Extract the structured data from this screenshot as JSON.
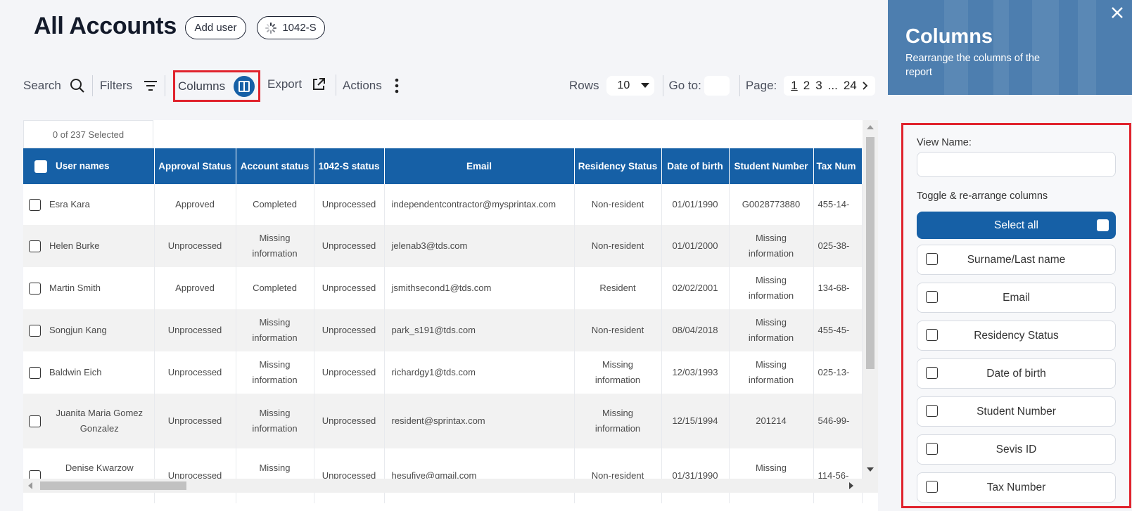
{
  "header": {
    "title": "All Accounts",
    "add_user": "Add user",
    "tag": "1042-S"
  },
  "toolbar": {
    "search": "Search",
    "filters": "Filters",
    "columns": "Columns",
    "export": "Export",
    "actions": "Actions",
    "rows_label": "Rows",
    "rows_value": "10",
    "goto_label": "Go to:",
    "page_label": "Page:",
    "pages": [
      "1",
      "2",
      "3",
      "...",
      "24"
    ]
  },
  "table": {
    "selected_count": "0 of 237 Selected",
    "columns": [
      "User names",
      "Approval Status",
      "Account status",
      "1042-S status",
      "Email",
      "Residency Status",
      "Date of birth",
      "Student Number",
      "Tax Num"
    ],
    "rows": [
      [
        "Esra Kara",
        "Approved",
        "Completed",
        "Unprocessed",
        "independentcontractor@mysprintax.com",
        "Non-resident",
        "01/01/1990",
        "G0028773880",
        "455-14-"
      ],
      [
        "Helen Burke",
        "Unprocessed",
        "Missing information",
        "Unprocessed",
        "jelenab3@tds.com",
        "Non-resident",
        "01/01/2000",
        "Missing information",
        "025-38-"
      ],
      [
        "Martin Smith",
        "Approved",
        "Completed",
        "Unprocessed",
        "jsmithsecond1@tds.com",
        "Resident",
        "02/02/2001",
        "Missing information",
        "134-68-"
      ],
      [
        "Songjun Kang",
        "Unprocessed",
        "Missing information",
        "Unprocessed",
        "park_s191@tds.com",
        "Non-resident",
        "08/04/2018",
        "Missing information",
        "455-45-"
      ],
      [
        "Baldwin Eich",
        "Unprocessed",
        "Missing information",
        "Unprocessed",
        "richardgy1@tds.com",
        "Missing information",
        "12/03/1993",
        "Missing information",
        "025-13-"
      ],
      [
        "Juanita Maria Gomez Gonzalez",
        "Unprocessed",
        "Missing information",
        "Unprocessed",
        "resident@sprintax.com",
        "Missing information",
        "12/15/1994",
        "201214",
        "546-99-"
      ],
      [
        "Denise Kwarzow Royalties",
        "Unprocessed",
        "Missing information",
        "Unprocessed",
        "hesufive@gmail.com",
        "Non-resident",
        "01/31/1990",
        "Missing information",
        "114-56-"
      ]
    ]
  },
  "panel": {
    "title": "Columns",
    "subtitle": "Rearrange the columns of the report",
    "view_name_label": "View Name:",
    "view_name_value": "",
    "toggle_label": "Toggle & re-arrange columns",
    "select_all": "Select all",
    "items": [
      "Surname/Last name",
      "Email",
      "Residency Status",
      "Date of birth",
      "Student Number",
      "Sevis ID",
      "Tax Number"
    ]
  },
  "colors": {
    "primary": "#1660a6",
    "panel_header": "#4d7eaf",
    "highlight": "#e0232d"
  }
}
